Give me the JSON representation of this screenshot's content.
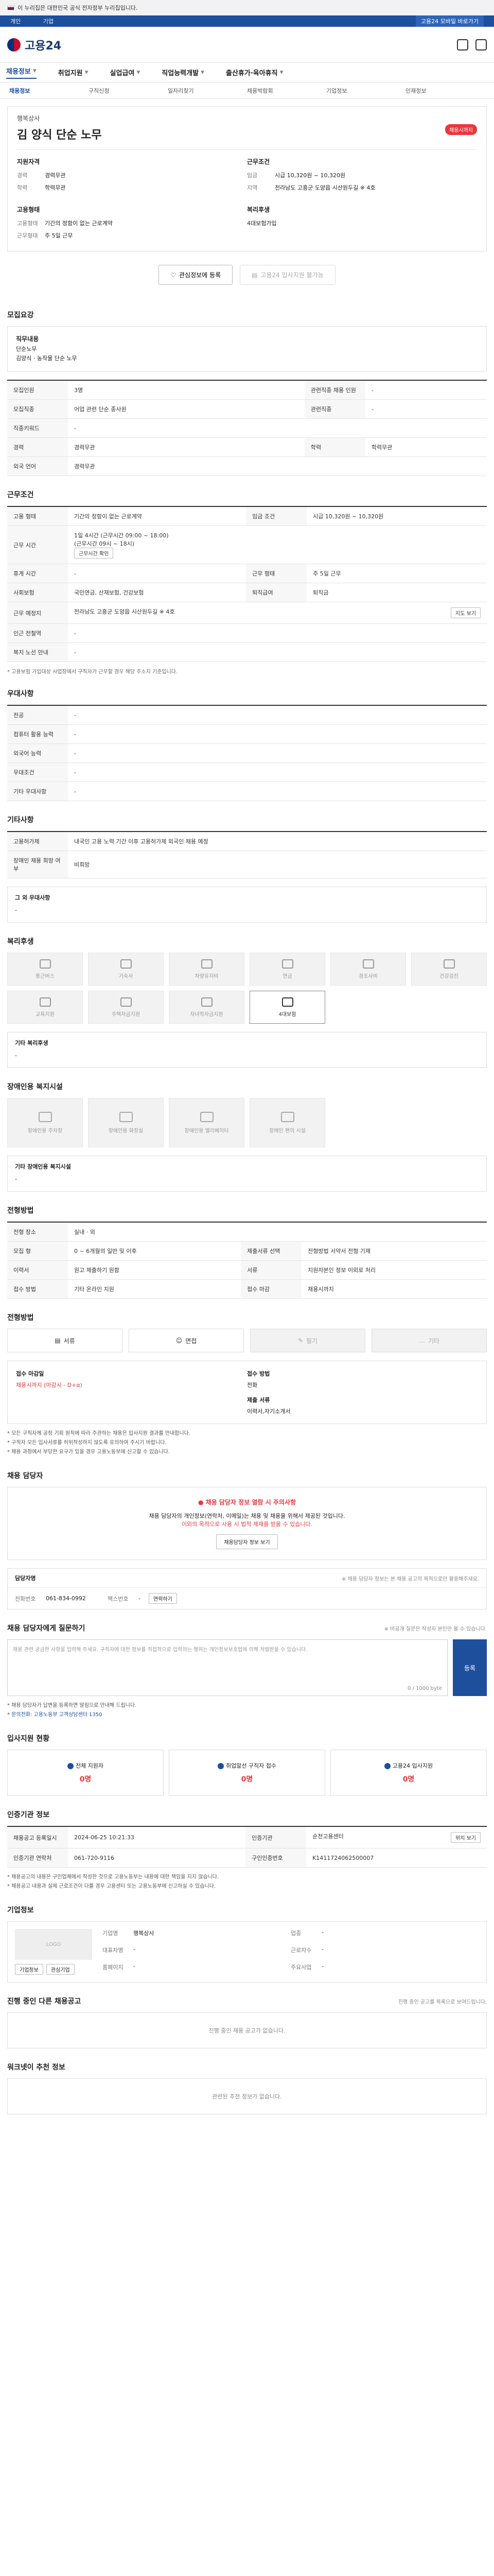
{
  "gov_strip": "이 누리집은 대한민국 공식 전자정부 누리집입니다.",
  "tabbar": {
    "tabs": [
      "개인",
      "기업"
    ],
    "right_tab": "고용24 모바일 바로가기"
  },
  "logo": "고용24",
  "gnb": [
    {
      "label": "채용정보",
      "active": true
    },
    {
      "label": "취업지원",
      "active": false
    },
    {
      "label": "실업급여",
      "active": false
    },
    {
      "label": "직업능력개발",
      "active": false
    },
    {
      "label": "출산휴가·육아휴직",
      "active": false
    }
  ],
  "subnav": [
    "채용정보",
    "구직신청",
    "일자리찾기",
    "채용박람회",
    "기업정보",
    "인재정보"
  ],
  "job": {
    "company": "행복상사",
    "title": "김 양식 단순 노무",
    "badge": "채용시까지",
    "summary_left_title": "지원자격",
    "summary_right_title": "근무조건",
    "qual": [
      {
        "k": "경력",
        "v": "경력무관"
      },
      {
        "k": "학력",
        "v": "학력무관"
      }
    ],
    "cond": [
      {
        "k": "임금",
        "v": "시급 10,320원 ~ 10,320원"
      },
      {
        "k": "지역",
        "v": "전라남도 고흥군 도양읍 시산원두길 ※ 4호"
      }
    ],
    "employ_title": "고용형태",
    "employ": [
      {
        "k": "고용형태",
        "v": "기간의 정함이 없는 근로계약"
      },
      {
        "k": "근무형태",
        "v": "주 5일 근무"
      }
    ],
    "benefit_title": "복리후생",
    "benefit": [
      {
        "k": "",
        "v": "4대보험가입"
      }
    ]
  },
  "actions": {
    "save": "관심정보에 등록",
    "apply": "고용24 입사지원 불가능"
  },
  "recruit": {
    "title": "모집요강",
    "duty_label": "직무내용",
    "duty_lines": [
      "단순노무",
      "김양식 · 농작물 단순 노무"
    ],
    "rows": [
      {
        "k": "모집인원",
        "v": "3명",
        "k2": "관련직종 채용 인원",
        "v2": "-"
      },
      {
        "k": "모집직종",
        "v": "어업 관련 단순 종사원",
        "k2": "관련직종",
        "v2": "-"
      },
      {
        "k": "직종키워드",
        "v": "-"
      },
      {
        "k": "경력",
        "v": "경력무관",
        "k2": "학력",
        "v2": "학력무관"
      },
      {
        "k": "외국 언어",
        "v": "경력무관"
      }
    ]
  },
  "work": {
    "title": "근무조건",
    "rows": [
      {
        "k": "고용 형태",
        "v": "기간의 정함이 없는 근로계약",
        "k2": "임금 조건",
        "v2": "시급 10,320원 ~ 10,320원"
      },
      {
        "k": "근무 시간",
        "v": "(근무시간 09시 ~ 18시)",
        "k2": "",
        "v2": ""
      },
      {
        "k": "휴게 시간",
        "v": "-",
        "k2": "근무 형태",
        "v2": "주 5일 근무"
      },
      {
        "k": "사회보험",
        "v": "국민연금, 산재보험, 건강보험",
        "k2": "퇴직급여",
        "v2": "퇴직금"
      },
      {
        "k": "근무 예정지",
        "v": "전라남도 고흥군 도양읍 시산원두길 ※ 4호",
        "k2": "",
        "v2": ""
      },
      {
        "k": "인근 전철역",
        "v": "-",
        "k2": "",
        "v2": ""
      },
      {
        "k": "복지 노선 안내",
        "v": "-",
        "k2": "",
        "v2": ""
      }
    ],
    "hours_extra": "1일 4시간 (근무시간 09:00 ~ 18:00)",
    "hours_btn": "근무시간 확인",
    "map_btn": "지도 보기",
    "note": "* 고용보험 가입대상 사업장에서 구직자가 근무할 경우 해당 주소지 기준입니다."
  },
  "pref": {
    "title": "우대사항",
    "rows": [
      {
        "k": "전공",
        "v": "-"
      },
      {
        "k": "컴퓨터 활용 능력",
        "v": "-"
      },
      {
        "k": "외국어 능력",
        "v": "-"
      },
      {
        "k": "우대조건",
        "v": "-"
      },
      {
        "k": "기타 우대사항",
        "v": "-"
      }
    ]
  },
  "other": {
    "title": "기타사항",
    "rows": [
      {
        "k": "고용허가제",
        "v": "내국인 고용 노력 기간 이후 고용허가제 외국인 채용 예정"
      },
      {
        "k": "장애인 채용 희망 여부",
        "v": "비희망"
      }
    ],
    "extra_title": "그 외 우대사항",
    "extra_value": "-"
  },
  "welfare": {
    "title": "복리후생",
    "tiles": [
      {
        "label": "통근버스",
        "on": false
      },
      {
        "label": "기숙사",
        "on": false
      },
      {
        "label": "차량유지비",
        "on": false
      },
      {
        "label": "연금",
        "on": false
      },
      {
        "label": "경조사비",
        "on": false
      },
      {
        "label": "건강검진",
        "on": false
      },
      {
        "label": "교육지원",
        "on": false
      },
      {
        "label": "주택자금지원",
        "on": false
      },
      {
        "label": "자녀학자금지원",
        "on": false
      },
      {
        "label": "4대보험",
        "on": true
      }
    ],
    "other_title": "기타 복리후생",
    "other_value": "-"
  },
  "disabled": {
    "title": "장애인용 복지시설",
    "tiles": [
      "장애인용 주차장",
      "장애인용 화장실",
      "장애인용 엘리베이터",
      "장애인 편의 시설"
    ],
    "other_title": "기타 장애인용 복지시설",
    "other_value": "-"
  },
  "process": {
    "title": "전형방법",
    "rows": [
      {
        "k": "전형 장소",
        "v": "실내 · 외"
      },
      {
        "k": "모집 형",
        "v": "0 ~ 6개월의 일반 및 이후",
        "k2": "제출서류 선택",
        "v2": "전형방법 서약서 전형 기재"
      },
      {
        "k": "이력서",
        "v": "원고 제출하기 원함",
        "k2": "서류",
        "v2": "지원자본인 정보 이외로 처리"
      },
      {
        "k": "접수 방법",
        "v": "기타 온라인 지원",
        "k2": "접수 마감",
        "v2": "채용시까지"
      }
    ]
  },
  "apply": {
    "title": "전형방법",
    "options": [
      {
        "label": "서류",
        "disabled": false
      },
      {
        "label": "면접",
        "disabled": false
      },
      {
        "label": "필기",
        "disabled": true
      },
      {
        "label": "기타",
        "disabled": true
      }
    ],
    "deadline_label": "접수 마감일",
    "deadline_value": "채용시까지 (마감시 - D+α)",
    "method_label": "접수 방법",
    "method_value": "전화",
    "docs_label": "제출 서류",
    "docs_value": "이력서,자기소개서",
    "bullets": [
      "* 모든 구직자께 공정 기회 원칙에 따라 주관하는 채용은 입사지원 결과를 안내합니다.",
      "* 구직자 모든 입사서류를 허위작성하지 않도록 유의하여 주시기 바랍니다.",
      "* 채용 과정에서 부당한 요구가 있을 경우 고용노동부에 신고할 수 있습니다."
    ]
  },
  "manager": {
    "title": "채용 담당자",
    "warn": "채용 담당자 정보 열람 시 주의사항",
    "lines": [
      "채용 담당자의 개인정보(연락처, 이메일)는 채용 및 채용을 위해서 제공된 것입니다.",
      "이외의 목적으로 사용 시 법적 제재를 받을 수 있습니다."
    ],
    "view_btn": "채용담당자 정보 보기",
    "name_label": "담당자명",
    "phone_label": "전화번호",
    "phone_value": "061-834-0992",
    "fax_label": "팩스번호",
    "fax_value": "-",
    "contact_btn": "연락하기",
    "hint": "※ 채용 담당자 정보는 본 채용 공고의 목적으로만 활용해주세요."
  },
  "qa": {
    "title": "채용 담당자에게 질문하기",
    "placeholder": "채용 관련 궁금한 사항을 입력해 주세요. 구직자에 대한 정보를 직접적으로 입력하는 행위는 개인정보보호법에 의해 처벌받을 수 있습니다.",
    "count": "0 / 1000 byte",
    "submit": "등록",
    "hint": "※ 비공개 질문은 작성자 본인만 볼 수 있습니다.",
    "bullets": [
      "* 채용 담당자가 답변을 등록하면 알림으로 안내해 드립니다.",
      "* 문의전화: 고용노동부 고객상담센터 1350"
    ]
  },
  "stats": {
    "title": "입사지원 현황",
    "items": [
      {
        "label": "전체 지원자",
        "value": "0명"
      },
      {
        "label": "취업알선 구직자 접수",
        "value": "0명"
      },
      {
        "label": "고용24 입사지원",
        "value": "0명"
      }
    ]
  },
  "agency": {
    "title": "인증기관 정보",
    "rows": [
      {
        "k": "채용공고 등록일시",
        "v": "2024-06-25 10:21:33",
        "k2": "인증기관",
        "v2": "순천고용센터"
      },
      {
        "k": "인증기관 연락처",
        "v": "061-720-9116",
        "k2": "구인인증번호",
        "v2": "K1411724062500007"
      }
    ],
    "btn": "위치 보기",
    "notes": [
      "* 채용공고의 내용은 구인업체에서 작성한 것으로 고용노동부는 내용에 대한 책임을 지지 않습니다.",
      "* 채용공고 내용과 실제 근로조건이 다를 경우 고용센터 또는 고용노동부에 신고하실 수 있습니다."
    ]
  },
  "company": {
    "title": "기업정보",
    "logo_text": "LOGO",
    "info": [
      {
        "k": "기업명",
        "v": "행복상사"
      },
      {
        "k": "업종",
        "v": "-"
      },
      {
        "k": "대표자명",
        "v": "-"
      },
      {
        "k": "근로자수",
        "v": "-"
      },
      {
        "k": "홈페이지",
        "v": "-"
      },
      {
        "k": "주요사업",
        "v": "-"
      }
    ],
    "btn1": "기업정보",
    "btn2": "관심기업"
  },
  "same": {
    "title": "진행 중인 다른 채용공고",
    "hint": "진행 중인 공고를 목록으로 보여드립니다.",
    "empty": "진행 중인 채용 공고가 없습니다."
  },
  "recommend": {
    "title": "워크넷이 추천 정보",
    "empty": "관련된 추천 정보가 없습니다."
  }
}
